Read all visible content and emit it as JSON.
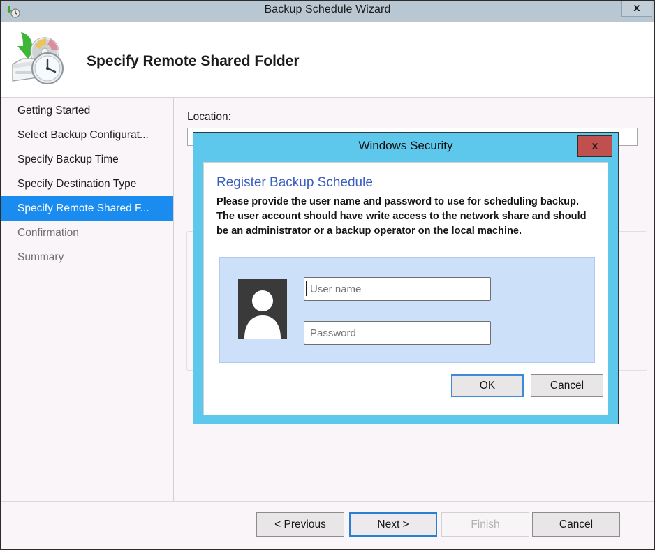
{
  "window": {
    "title": "Backup Schedule Wizard",
    "icon": "backup-clock-icon",
    "close_label": "x"
  },
  "header": {
    "title": "Specify Remote Shared Folder",
    "icon": "backup-disk-clock-icon"
  },
  "sidebar": {
    "items": [
      {
        "label": "Getting Started",
        "state": "done"
      },
      {
        "label": "Select Backup Configurat...",
        "state": "done"
      },
      {
        "label": "Specify Backup Time",
        "state": "done"
      },
      {
        "label": "Specify Destination Type",
        "state": "done"
      },
      {
        "label": "Specify Remote Shared F...",
        "state": "selected"
      },
      {
        "label": "Confirmation",
        "state": "pending"
      },
      {
        "label": "Summary",
        "state": "pending"
      }
    ]
  },
  "content": {
    "location_label": "Location:",
    "location_value": ""
  },
  "footer": {
    "previous": "< Previous",
    "next": "Next >",
    "finish": "Finish",
    "cancel": "Cancel"
  },
  "dialog": {
    "title": "Windows Security",
    "close_label": "x",
    "heading": "Register Backup Schedule",
    "description": "Please provide the user name and password to use for scheduling backup. The user account should have write access to the network share and should be an administrator or a backup operator on the local machine.",
    "username_placeholder": "User name",
    "username_value": "",
    "password_placeholder": "Password",
    "password_value": "",
    "ok": "OK",
    "cancel": "Cancel"
  },
  "colors": {
    "titlebar": "#b9c7d2",
    "accent_cyan": "#5ec8ec",
    "selection_blue": "#1a8cf0",
    "close_red": "#c0504d",
    "cred_panel_blue": "#cde0fa",
    "heading_blue": "#3b5fc0",
    "page_bg": "#faf5f8"
  }
}
